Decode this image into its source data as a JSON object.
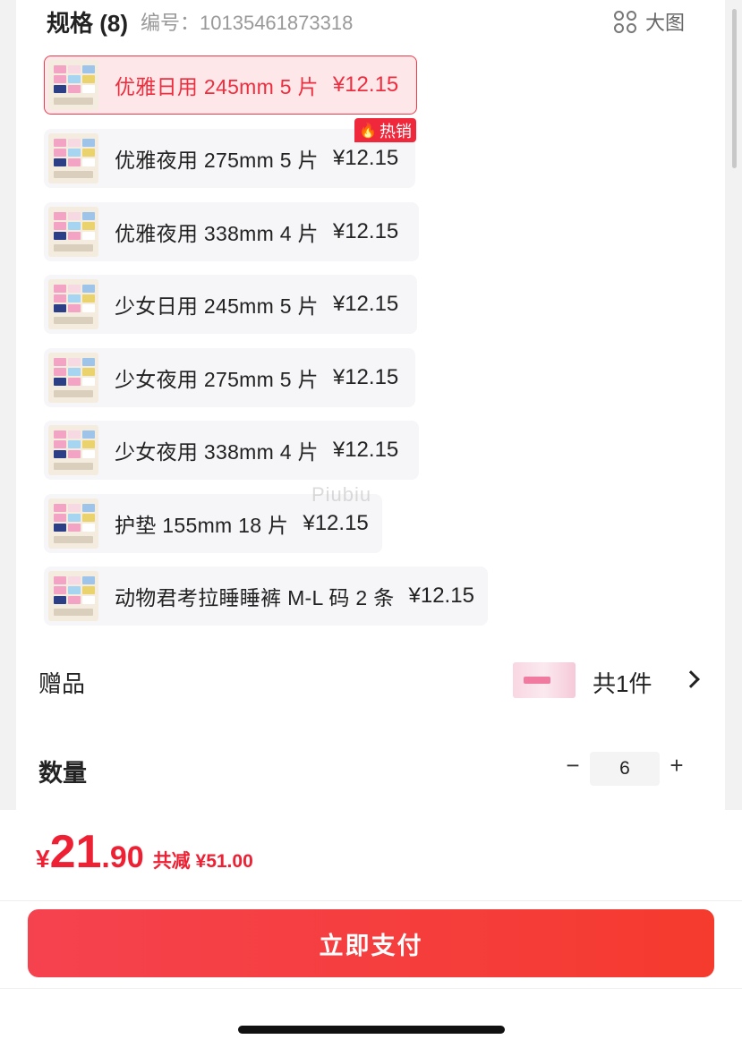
{
  "spec": {
    "title": "规格 (8)",
    "code_text": "编号：10135461873318",
    "big_image_label": "大图"
  },
  "spec_items": [
    {
      "label": "优雅日用 245mm 5 片",
      "price": "¥12.15",
      "selected": true
    },
    {
      "label": "优雅夜用 275mm 5 片",
      "price": "¥12.15",
      "badge": "热销"
    },
    {
      "label": "优雅夜用 338mm 4 片",
      "price": "¥12.15"
    },
    {
      "label": "少女日用 245mm 5 片",
      "price": "¥12.15"
    },
    {
      "label": "少女夜用 275mm 5 片",
      "price": "¥12.15"
    },
    {
      "label": "少女夜用 338mm 4 片",
      "price": "¥12.15"
    },
    {
      "label": "护垫 155mm 18 片",
      "price": "¥12.15"
    },
    {
      "label": "动物君考拉睡睡裤 M-L 码 2 条",
      "price": "¥12.15"
    }
  ],
  "hot_badge": "热销",
  "watermark": "Piubiu",
  "gift": {
    "label": "赠品",
    "count_text": "共1件"
  },
  "quantity": {
    "label": "数量",
    "minus": "−",
    "value": "6",
    "plus": "+"
  },
  "price_bar": {
    "currency": "¥",
    "integer": "21",
    "decimal": ".90",
    "discount_text": "共减 ¥51.00"
  },
  "pay_button_label": "立即支付",
  "colors": {
    "accent": "#ee2033",
    "selected_bg": "#fde7e9",
    "button_start": "#f5424f",
    "button_end": "#f53a2e"
  },
  "icons": {
    "big_image": "grid-icon",
    "hot": "flame-icon",
    "gift_nav": "chevron-right-icon"
  }
}
